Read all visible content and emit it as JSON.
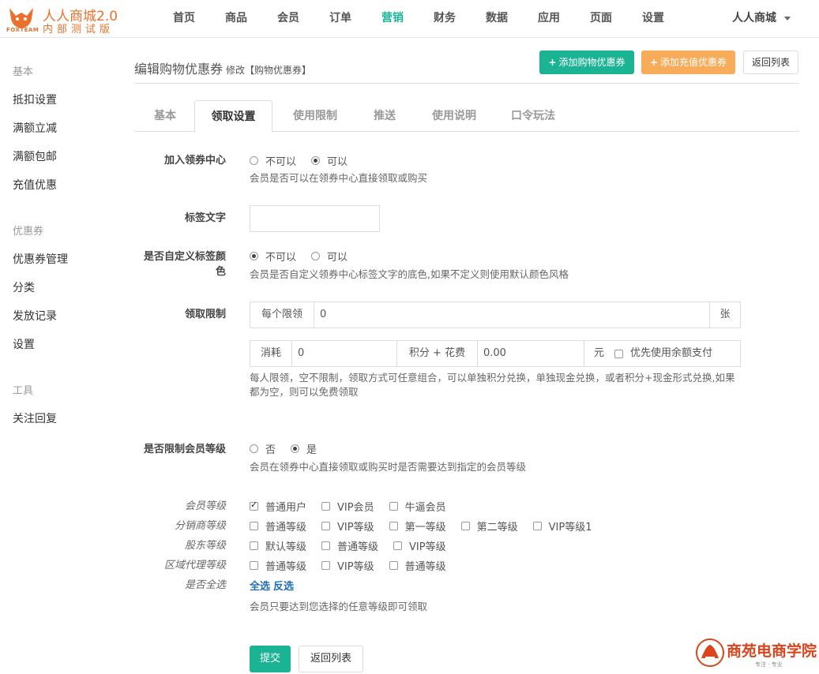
{
  "brand": {
    "name": "人人商城2.0",
    "sub": "内部测试版",
    "team": "FOXTEAM",
    "color": "#e8712e"
  },
  "nav": {
    "items": [
      "首页",
      "商品",
      "会员",
      "订单",
      "营销",
      "财务",
      "数据",
      "应用",
      "页面",
      "设置"
    ],
    "active": "营销",
    "user": "人人商城"
  },
  "sidebar": {
    "group_basic": "基本",
    "basic_items": [
      "抵扣设置",
      "满额立减",
      "满额包邮",
      "充值优惠"
    ],
    "group_coupon": "优惠券",
    "coupon_items": [
      "优惠券管理",
      "分类",
      "发放记录",
      "设置"
    ],
    "group_tools": "工具",
    "tools_items": [
      "关注回复"
    ]
  },
  "header": {
    "title": "编辑购物优惠券",
    "subtitle": "修改【购物优惠券】",
    "btn_add_shop": "添加购物优惠券",
    "btn_add_recharge": "添加充值优惠券",
    "btn_back": "返回列表"
  },
  "tabs": [
    "基本",
    "领取设置",
    "使用限制",
    "推送",
    "使用说明",
    "口令玩法"
  ],
  "form": {
    "center_label": "加入领券中心",
    "center_opt_no": "不可以",
    "center_opt_yes": "可以",
    "center_help": "会员是否可以在领券中心直接领取或购买",
    "tag_label": "标签文字",
    "tag_value": "",
    "custom_label": "是否自定义标签颜色",
    "custom_opt_no": "不可以",
    "custom_opt_yes": "可以",
    "custom_help": "会员是否自定义领券中心标签文字的底色,如果不定义则使用默认颜色风格",
    "limit_label": "领取限制",
    "per_limit_addon": "每个限领",
    "per_limit_value": "0",
    "per_limit_unit": "张",
    "cost_addon": "消耗",
    "cost_value": "0",
    "points_addon": "积分 + 花费",
    "money_value": "0.00",
    "money_unit": "元",
    "balance_check": "优先使用余额支付",
    "limit_help": "每人限领，空不限制，领取方式可任意组合，可以单独积分兑换，单独现金兑换，或者积分+现金形式兑换,如果都为空，则可以免费领取",
    "level_limit_label": "是否限制会员等级",
    "level_opt_no": "否",
    "level_opt_yes": "是",
    "level_help": "会员在领券中心直接领取或购买时是否需要达到指定的会员等级",
    "member_level_label": "会员等级",
    "member_levels": [
      "普通用户",
      "VIP会员",
      "牛逼会员"
    ],
    "dist_level_label": "分销商等级",
    "dist_levels": [
      "普通等级",
      "VIP等级",
      "第一等级",
      "第二等级",
      "VIP等级1"
    ],
    "share_level_label": "股东等级",
    "share_levels": [
      "默认等级",
      "普通等级",
      "VIP等级"
    ],
    "region_level_label": "区域代理等级",
    "region_levels": [
      "普通等级",
      "VIP等级",
      "普通等级"
    ],
    "select_all_label": "是否全选",
    "select_all": "全选",
    "select_invert": "反选",
    "any_level_help": "会员只要达到您选择的任意等级即可领取",
    "submit": "提交",
    "back": "返回列表"
  },
  "watermark": {
    "text": "商苑电商学院",
    "slogan": "专注 · 专业"
  },
  "colors": {
    "green": "#1ab394",
    "orange": "#f8ac59",
    "link": "#1f6fb5"
  }
}
